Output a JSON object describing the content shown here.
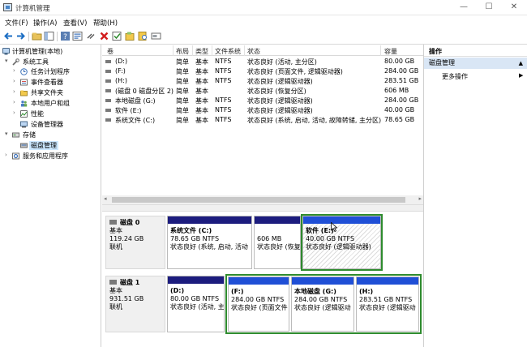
{
  "window": {
    "title": "计算机管理",
    "minimize_glyph": "—",
    "maximize_glyph": "☐",
    "close_glyph": "✕"
  },
  "menu": [
    "文件(F)",
    "操作(A)",
    "查看(V)",
    "帮助(H)"
  ],
  "toolbar_icons": [
    "back-icon",
    "forward-icon",
    "up-folder-icon",
    "show-hide-tree-icon",
    "help-icon",
    "properties-icon",
    "connect-icon",
    "delete-icon",
    "check-icon",
    "folder-open-icon",
    "search-icon",
    "disk-view-icon"
  ],
  "tree": {
    "root": "计算机管理(本地)",
    "items": [
      {
        "label": "系统工具",
        "level": 1,
        "expander": "▾",
        "icon": "tools-icon"
      },
      {
        "label": "任务计划程序",
        "level": 2,
        "expander": "›",
        "icon": "task-scheduler-icon"
      },
      {
        "label": "事件查看器",
        "level": 2,
        "expander": "›",
        "icon": "event-viewer-icon"
      },
      {
        "label": "共享文件夹",
        "level": 2,
        "expander": "›",
        "icon": "shared-folder-icon"
      },
      {
        "label": "本地用户和组",
        "level": 2,
        "expander": "›",
        "icon": "users-icon"
      },
      {
        "label": "性能",
        "level": 2,
        "expander": "›",
        "icon": "performance-icon"
      },
      {
        "label": "设备管理器",
        "level": 2,
        "expander": "",
        "icon": "device-manager-icon"
      },
      {
        "label": "存储",
        "level": 1,
        "expander": "▾",
        "icon": "storage-icon"
      },
      {
        "label": "磁盘管理",
        "level": 2,
        "expander": "",
        "icon": "disk-management-icon",
        "selected": true
      },
      {
        "label": "服务和应用程序",
        "level": 1,
        "expander": "›",
        "icon": "services-icon"
      }
    ]
  },
  "table": {
    "headers": [
      "卷",
      "布局",
      "类型",
      "文件系统",
      "状态",
      "容量"
    ],
    "rows": [
      [
        "(D:)",
        "简单",
        "基本",
        "NTFS",
        "状态良好 (活动, 主分区)",
        "80.00 GB"
      ],
      [
        "(F:)",
        "简单",
        "基本",
        "NTFS",
        "状态良好 (页面文件, 逻辑驱动器)",
        "284.00 GB"
      ],
      [
        "(H:)",
        "简单",
        "基本",
        "NTFS",
        "状态良好 (逻辑驱动器)",
        "283.51 GB"
      ],
      [
        "(磁盘 0 磁盘分区 2)",
        "简单",
        "基本",
        "",
        "状态良好 (恢复分区)",
        "606 MB"
      ],
      [
        "本地磁盘 (G:)",
        "简单",
        "基本",
        "NTFS",
        "状态良好 (逻辑驱动器)",
        "284.00 GB"
      ],
      [
        "软件 (E:)",
        "简单",
        "基本",
        "NTFS",
        "状态良好 (逻辑驱动器)",
        "40.00 GB"
      ],
      [
        "系统文件 (C:)",
        "简单",
        "基本",
        "NTFS",
        "状态良好 (系统, 启动, 活动, 故障转储, 主分区)",
        "78.65 GB"
      ]
    ]
  },
  "disks": [
    {
      "name": "磁盘 0",
      "type": "基本",
      "size": "119.24 GB",
      "status": "联机",
      "partitions": [
        {
          "title": "系统文件  (C:)",
          "size": "78.65 GB NTFS",
          "status": "状态良好 (系统, 启动, 活动"
        },
        {
          "title": "",
          "size": "606 MB",
          "status": "状态良好 (恢复"
        },
        {
          "title": "软件  (E:)",
          "size": "40.00 GB NTFS",
          "status": "状态良好 (逻辑驱动器)"
        }
      ]
    },
    {
      "name": "磁盘 1",
      "type": "基本",
      "size": "931.51 GB",
      "status": "联机",
      "partitions": [
        {
          "title": "(D:)",
          "size": "80.00 GB NTFS",
          "status": "状态良好 (活动, 主"
        },
        {
          "title": "(F:)",
          "size": "284.00 GB NTFS",
          "status": "状态良好 (页面文件"
        },
        {
          "title": "本地磁盘  (G:)",
          "size": "284.00 GB NTFS",
          "status": "状态良好 (逻辑驱动"
        },
        {
          "title": "(H:)",
          "size": "283.51 GB NTFS",
          "status": "状态良好 (逻辑驱动"
        }
      ]
    }
  ],
  "actions": {
    "header": "操作",
    "section": "磁盘管理",
    "section_caret": "▲",
    "more": "更多操作",
    "more_arrow": "▶"
  },
  "colors": {
    "primary_partition_bar": "#1c1c7e",
    "logical_partition_bar": "#1f4fd6",
    "extended_frame": "#2e8b2e",
    "selection_highlight": "#cce8ff",
    "action_section_bg": "#d9e6f5"
  }
}
